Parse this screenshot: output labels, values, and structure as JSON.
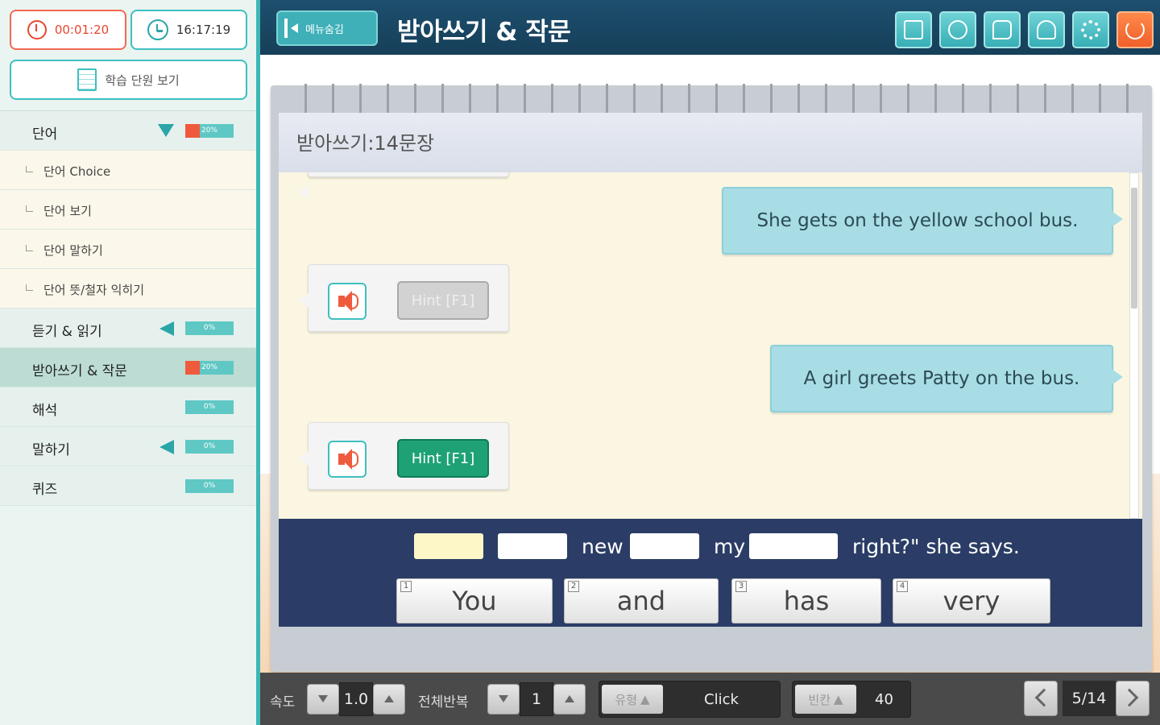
{
  "sidebar": {
    "timer": "00:01:20",
    "clock": "16:17:19",
    "unit_button": "학습 단원 보기",
    "menu": [
      {
        "label": "단어",
        "type": "main",
        "progress": "20%",
        "progress_value": 20,
        "indicator": "down"
      },
      {
        "label": "단어 Choice",
        "type": "sub"
      },
      {
        "label": "단어 보기",
        "type": "sub"
      },
      {
        "label": "단어 말하기",
        "type": "sub"
      },
      {
        "label": "단어 뜻/철자 익히기",
        "type": "sub"
      },
      {
        "label": "듣기 & 읽기",
        "type": "main",
        "progress": "0%",
        "progress_value": 0,
        "indicator": "left"
      },
      {
        "label": "받아쓰기 & 작문",
        "type": "main",
        "progress": "20%",
        "progress_value": 20,
        "active": true
      },
      {
        "label": "해석",
        "type": "main",
        "progress": "0%",
        "progress_value": 0
      },
      {
        "label": "말하기",
        "type": "main",
        "progress": "0%",
        "progress_value": 0,
        "indicator": "left"
      },
      {
        "label": "퀴즈",
        "type": "main",
        "progress": "0%",
        "progress_value": 0
      }
    ]
  },
  "header": {
    "menu_hide_label": "메뉴숨김",
    "title": "받아쓰기 & 작문",
    "toolbar_icons": [
      "dictionary-icon",
      "p-icon",
      "chat-icon",
      "trophy-icon",
      "settings-icon",
      "power-icon"
    ]
  },
  "notebook": {
    "title": "받아쓰기:14문장",
    "messages": [
      "She gets on the yellow school bus.",
      "A girl greets Patty on the bus."
    ],
    "hint_label": "Hint [F1]"
  },
  "answer": {
    "words": [
      "new",
      "my",
      "right?\" she says."
    ],
    "choices": [
      {
        "num": "1",
        "text": "You"
      },
      {
        "num": "2",
        "text": "and"
      },
      {
        "num": "3",
        "text": "has"
      },
      {
        "num": "4",
        "text": "very"
      }
    ]
  },
  "bottom": {
    "speed_label": "속도",
    "speed_value": "1.0",
    "repeat_label": "전체반복",
    "repeat_value": "1",
    "type_tag": "유형",
    "type_value": "Click",
    "blank_tag": "빈칸",
    "blank_value": "40",
    "page": "5/14"
  },
  "colors": {
    "accent": "#3fbfc0",
    "header": "#1d4f6e",
    "bubble": "#a8dde6",
    "answer_panel": "#2b3d66",
    "hint_active": "#1ea275",
    "progress_fill": "#f05a3c"
  }
}
